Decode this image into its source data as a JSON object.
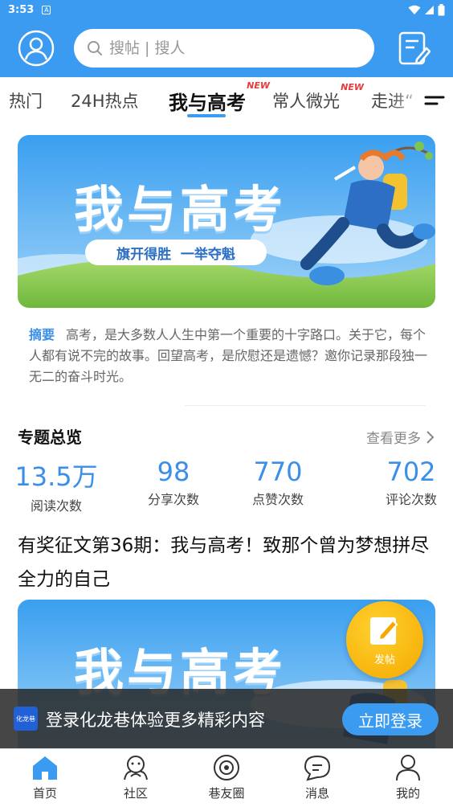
{
  "status": {
    "time": "3:53",
    "notif": "A"
  },
  "header": {
    "search_placeholder": "搜帖 | 搜人"
  },
  "tabs": [
    {
      "label": "热门",
      "new": ""
    },
    {
      "label": "24H热点",
      "new": ""
    },
    {
      "label": "我与高考",
      "new": "NEW",
      "active": true
    },
    {
      "label": "常人微光",
      "new": "NEW"
    },
    {
      "label": "走进“",
      "new": ""
    }
  ],
  "banner": {
    "title": "我与高考",
    "slogan": "旗开得胜  一举夺魁"
  },
  "summary": {
    "tag": "摘要",
    "text": "高考，是大多数人人生中第一个重要的十字路口。关于它，每个人都有说不完的故事。回望高考，是欣慰还是遗憾？邀你记录那段独一无二的奋斗时光。"
  },
  "overview": {
    "title": "专题总览",
    "more": "查看更多",
    "stats": [
      {
        "value": "13.5万",
        "label": "阅读次数"
      },
      {
        "value": "98",
        "label": "分享次数"
      },
      {
        "value": "770",
        "label": "点赞次数"
      },
      {
        "value": "702",
        "label": "评论次数"
      }
    ]
  },
  "post": {
    "title": "有奖征文第36期：我与高考！致那个曾为梦想拼尽全力的自己"
  },
  "fab": {
    "label": "发帖"
  },
  "login_bar": {
    "logo": "化龙巷",
    "text": "登录化龙巷体验更多精彩内容",
    "button": "立即登录"
  },
  "bottom_nav": [
    {
      "label": "首页",
      "icon": "home-icon",
      "active": true
    },
    {
      "label": "社区",
      "icon": "community-icon"
    },
    {
      "label": "巷友圈",
      "icon": "circle-icon"
    },
    {
      "label": "消息",
      "icon": "message-icon"
    },
    {
      "label": "我的",
      "icon": "profile-icon"
    }
  ],
  "colors": {
    "brand": "#3b9bf0",
    "accent_text": "#3b8fe8",
    "new_badge": "#e83a3a",
    "fab": "#f5a800"
  }
}
